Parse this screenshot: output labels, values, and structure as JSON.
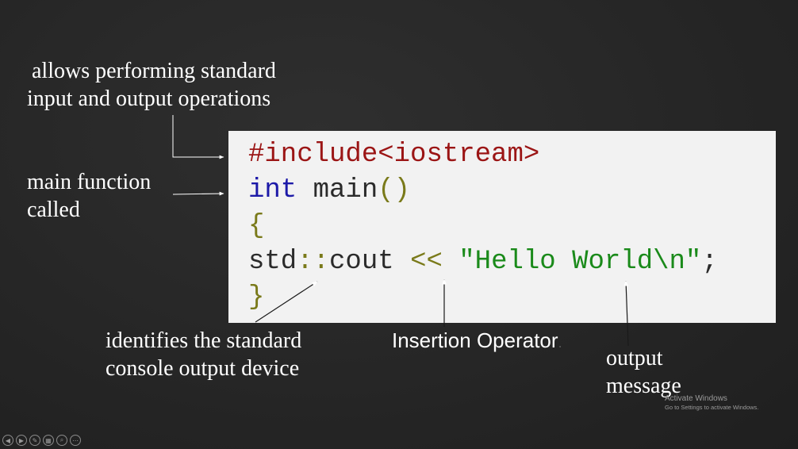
{
  "annotations": {
    "iostream_desc": [
      "allows performing standard",
      "input and output operations"
    ],
    "main_desc": [
      "main function",
      "called"
    ],
    "cout_desc": [
      "identifies the standard",
      "console output device"
    ],
    "insertion_label": "Insertion Operator",
    "insertion_trailing": ".",
    "output_desc": [
      "output",
      "message"
    ]
  },
  "code": {
    "line1": {
      "directive": "#include",
      "header": "<iostream>"
    },
    "line2": {
      "type": "int",
      "name": " main",
      "parens": "()"
    },
    "line3": {
      "brace": "{"
    },
    "line4": {
      "ns": "std",
      "scope": "::",
      "obj": "cout",
      "sp1": " ",
      "op": "<<",
      "sp2": " ",
      "str": "\"Hello World\\n\"",
      "semi": ";"
    },
    "line5": {
      "brace": "}"
    }
  },
  "watermark": {
    "title": "Activate Windows",
    "subtitle": "Go to Settings to activate Windows."
  },
  "slide_controls": [
    {
      "icon": "previous-slide-icon",
      "glyph": "◀"
    },
    {
      "icon": "next-slide-icon",
      "glyph": "▶"
    },
    {
      "icon": "pen-icon",
      "glyph": "✎"
    },
    {
      "icon": "all-slides-icon",
      "glyph": "▦"
    },
    {
      "icon": "zoom-icon",
      "glyph": "⌕"
    },
    {
      "icon": "more-options-icon",
      "glyph": "⋯"
    }
  ],
  "colors": {
    "background": "#262626",
    "code_background": "#f2f2f2",
    "directive": "#9b1515",
    "keyword": "#1d1aa8",
    "punctuation": "#7a7a1a",
    "string": "#1a8a1a"
  }
}
